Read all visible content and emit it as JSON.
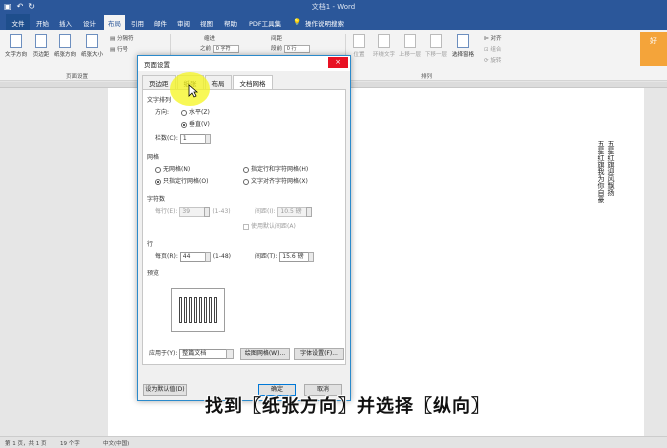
{
  "app": {
    "title": "文档1 - Word"
  },
  "tabs": [
    {
      "label": "文件"
    },
    {
      "label": "开始"
    },
    {
      "label": "插入"
    },
    {
      "label": "设计"
    },
    {
      "label": "布局"
    },
    {
      "label": "引用"
    },
    {
      "label": "邮件"
    },
    {
      "label": "审阅"
    },
    {
      "label": "视图"
    },
    {
      "label": "帮助"
    },
    {
      "label": "PDF工具集"
    },
    {
      "label": "操作说明搜索"
    }
  ],
  "ribbon": {
    "text_direction": "文字方向",
    "margins": "页边距",
    "orientation": "纸张方向",
    "size": "纸张大小",
    "breaks": "分隔符",
    "line_numbers": "行号",
    "indent_label": "缩进",
    "spacing_label": "间距",
    "indent_left": "之前",
    "indent_value": "0 字符",
    "spacing_after": "段前",
    "spacing_value": "0 行",
    "group_page_setup": "页面设置",
    "group_arrange": "排列",
    "position": "位置",
    "wrap_text": "环绕文字",
    "bring_forward": "上移一层",
    "send_backward": "下移一层",
    "selection_pane": "选择窗格",
    "align": "对齐",
    "group": "组合",
    "rotate": "旋转"
  },
  "avatar_text": "好",
  "dialog": {
    "title": "页面设置",
    "close": "×",
    "tabs": [
      "页边距",
      "纸张",
      "布局",
      "文档网格"
    ],
    "text_arrangement": "文字排列",
    "direction_label": "方向:",
    "horizontal": "水平(Z)",
    "vertical": "垂直(V)",
    "columns_label": "栏数(C):",
    "columns_value": "1",
    "grid_label": "网格",
    "no_grid": "无网格(N)",
    "line_char_grid": "指定行和字符网格(H)",
    "line_grid_only": "只指定行网格(O)",
    "snap_chars": "文字对齐字符网格(X)",
    "chars_label": "字符数",
    "per_line": "每行(E):",
    "per_line_value": "39",
    "per_line_range": "(1-43)",
    "pitch_label": "间距(I):",
    "pitch_value": "10.5 磅",
    "use_default_pitch": "使用默认间距(A)",
    "lines_label": "行",
    "per_page": "每页(R):",
    "per_page_value": "44",
    "per_page_range": "(1-48)",
    "line_pitch_label": "间距(T):",
    "line_pitch_value": "15.6 磅",
    "preview_label": "预览",
    "apply_to": "应用于(Y):",
    "apply_value": "整篇文档",
    "draw_grid": "绘图网格(W)...",
    "font_settings": "字体设置(F)...",
    "set_default": "设为默认值(D)",
    "ok": "确定",
    "cancel": "取消"
  },
  "document": {
    "line1": "五星红旗迎风飘扬",
    "line2": "五星红旗我为你自豪"
  },
  "subtitle": "找到〖纸张方向〗并选择〖纵向〗",
  "status": {
    "page": "第 1 页，共 1 页",
    "words": "19 个字",
    "lang": "中文(中国)"
  }
}
